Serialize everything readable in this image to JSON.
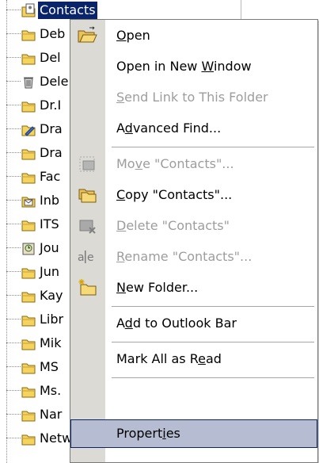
{
  "tree": {
    "items": [
      {
        "label": "Contacts",
        "icon": "contacts-folder-icon",
        "selected": true
      },
      {
        "label": "Deb",
        "icon": "folder-icon"
      },
      {
        "label": "Del",
        "icon": "folder-icon"
      },
      {
        "label": "Dele",
        "icon": "deleted-items-icon"
      },
      {
        "label": "Dr.I",
        "icon": "folder-icon"
      },
      {
        "label": "Dra",
        "icon": "drafts-icon"
      },
      {
        "label": "Dra",
        "icon": "folder-icon"
      },
      {
        "label": "Fac",
        "icon": "folder-icon"
      },
      {
        "label": "Inb",
        "icon": "inbox-icon"
      },
      {
        "label": "ITS",
        "icon": "folder-icon"
      },
      {
        "label": "Jou",
        "icon": "journal-icon"
      },
      {
        "label": "Jun",
        "icon": "folder-icon"
      },
      {
        "label": "Kay",
        "icon": "folder-icon"
      },
      {
        "label": "Libr",
        "icon": "folder-icon"
      },
      {
        "label": "Mik",
        "icon": "folder-icon"
      },
      {
        "label": "MS",
        "icon": "folder-icon"
      },
      {
        "label": "Ms.",
        "icon": "folder-icon"
      },
      {
        "label": "Nar",
        "icon": "folder-icon"
      },
      {
        "label": "Network",
        "icon": "folder-icon"
      }
    ]
  },
  "menu": {
    "open": {
      "pre": "",
      "mn": "O",
      "post": "pen"
    },
    "open_new_window": {
      "pre": "Open in New ",
      "mn": "W",
      "post": "indow"
    },
    "send_link": {
      "pre": "",
      "mn": "S",
      "post": "end Link to This Folder"
    },
    "advanced_find": {
      "pre": "A",
      "mn": "d",
      "post": "vanced Find..."
    },
    "move": {
      "pre": "Mo",
      "mn": "v",
      "post": "e \"Contacts\"..."
    },
    "copy": {
      "pre": "",
      "mn": "C",
      "post": "opy \"Contacts\"..."
    },
    "delete": {
      "pre": "",
      "mn": "D",
      "post": "elete \"Contacts\""
    },
    "rename": {
      "pre": "",
      "mn": "R",
      "post": "ename \"Contacts\"..."
    },
    "new_folder": {
      "pre": "",
      "mn": "N",
      "post": "ew Folder..."
    },
    "add_outlook_bar": {
      "pre": "A",
      "mn": "d",
      "post": "d to Outlook Bar"
    },
    "mark_all_read": {
      "pre": "Mark All as R",
      "mn": "e",
      "post": "ad"
    },
    "properties": {
      "pre": "Propert",
      "mn": "i",
      "post": "es"
    }
  },
  "colors": {
    "selection": "#0a246a",
    "menu_hover": "#b6bdd2",
    "folder_yellow": "#f4d35e",
    "disabled_text": "#9d9d9d"
  }
}
